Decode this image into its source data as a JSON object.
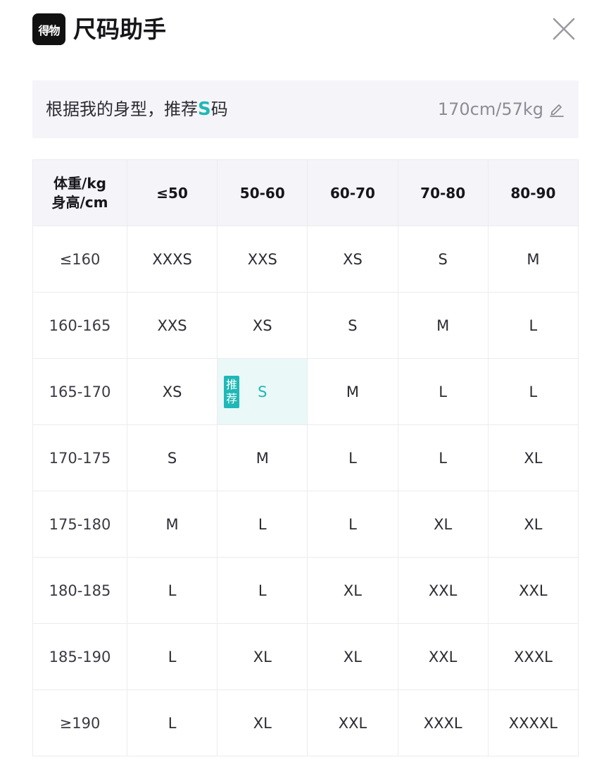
{
  "header": {
    "logo_text": "得物",
    "title": "尺码助手"
  },
  "recommendation": {
    "prefix": "根据我的身型，推荐",
    "size": "S",
    "suffix": "码",
    "body_info": "170cm/57kg"
  },
  "table": {
    "corner_line1": "体重/kg",
    "corner_line2": "身高/cm",
    "columns": [
      "≤50",
      "50-60",
      "60-70",
      "70-80",
      "80-90"
    ],
    "rows": [
      {
        "height": "≤160",
        "sizes": [
          "XXXS",
          "XXS",
          "XS",
          "S",
          "M"
        ]
      },
      {
        "height": "160-165",
        "sizes": [
          "XXS",
          "XS",
          "S",
          "M",
          "L"
        ]
      },
      {
        "height": "165-170",
        "sizes": [
          "XS",
          "S",
          "M",
          "L",
          "L"
        ]
      },
      {
        "height": "170-175",
        "sizes": [
          "S",
          "M",
          "L",
          "L",
          "XL"
        ]
      },
      {
        "height": "175-180",
        "sizes": [
          "M",
          "L",
          "L",
          "XL",
          "XL"
        ]
      },
      {
        "height": "180-185",
        "sizes": [
          "L",
          "L",
          "XL",
          "XXL",
          "XXL"
        ]
      },
      {
        "height": "185-190",
        "sizes": [
          "L",
          "XL",
          "XL",
          "XXL",
          "XXXL"
        ]
      },
      {
        "height": "≥190",
        "sizes": [
          "L",
          "XL",
          "XXL",
          "XXXL",
          "XXXXL"
        ]
      }
    ],
    "recommended_row": 2,
    "recommended_col": 1,
    "badge_text": "推荐"
  },
  "colors": {
    "accent": "#1fb8b6",
    "highlight_bg": "#eaf8f8",
    "header_bg": "#f5f5f9"
  },
  "icons": {
    "logo": "app-logo",
    "close": "close-icon",
    "edit": "pencil-icon"
  }
}
